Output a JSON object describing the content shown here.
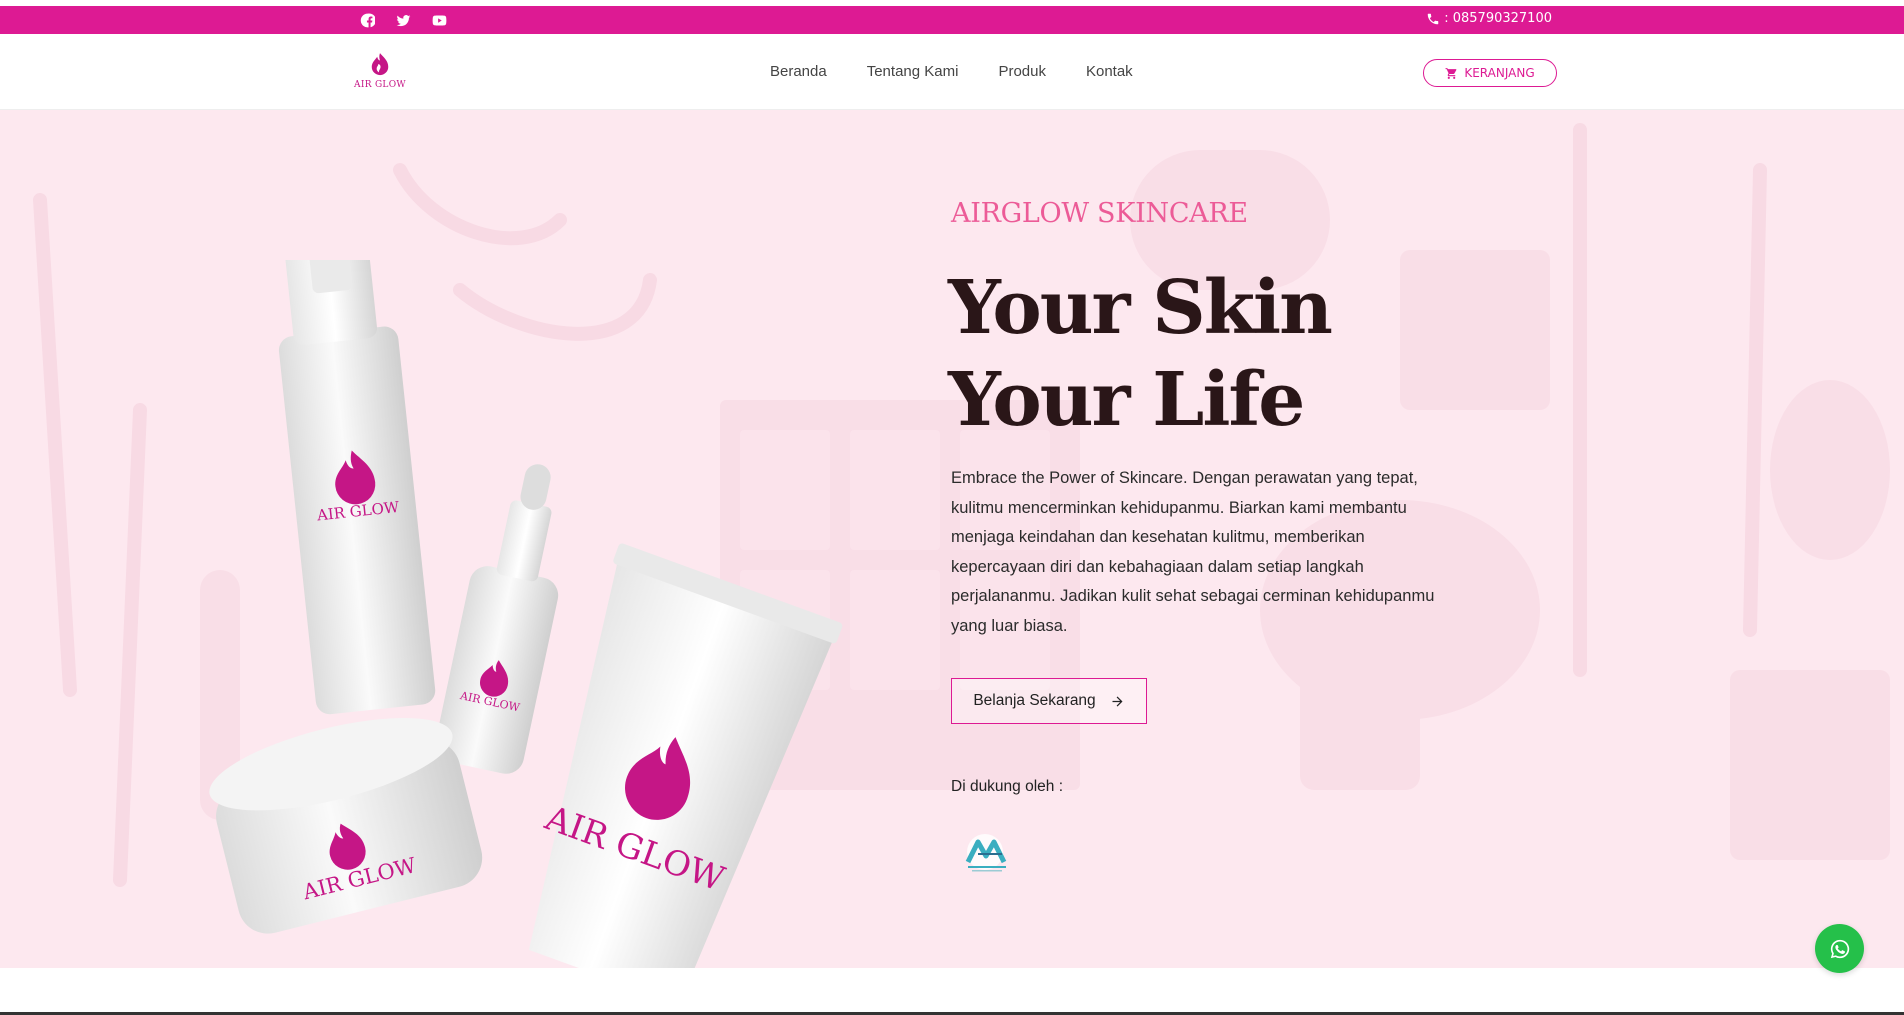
{
  "topbar": {
    "socials": [
      "facebook-icon",
      "twitter-icon",
      "youtube-icon"
    ],
    "phone": ": 085790327100",
    "color": "#dd1a93"
  },
  "header": {
    "logo_text": "AIR GLOW",
    "nav": [
      "Beranda",
      "Tentang Kami",
      "Produk",
      "Kontak"
    ],
    "cart_label": "KERANJANG"
  },
  "hero": {
    "eyebrow": "AIRGLOW SKINCARE",
    "headline_line1": "Your Skin",
    "headline_line2": "Your Life",
    "description": "Embrace the Power of Skincare. Dengan perawatan yang tepat, kulitmu mencerminkan kehidupanmu. Biarkan kami membantu menjaga keindahan dan kesehatan kulitmu, memberikan kepercayaan diri dan kebahagiaan dalam setiap langkah perjalananmu. Jadikan kulit sehat sebagai cerminan kehidupanmu yang luar biasa.",
    "cta_label": "Belanja Sekarang",
    "support_label": "Di dukung oleh :",
    "product_brand": "AIR GLOW",
    "background": "#fde8ef"
  },
  "colors": {
    "accent": "#dd1a93",
    "eyebrow": "#ec5b97",
    "headline": "#2a1618",
    "whatsapp": "#25c04a"
  }
}
